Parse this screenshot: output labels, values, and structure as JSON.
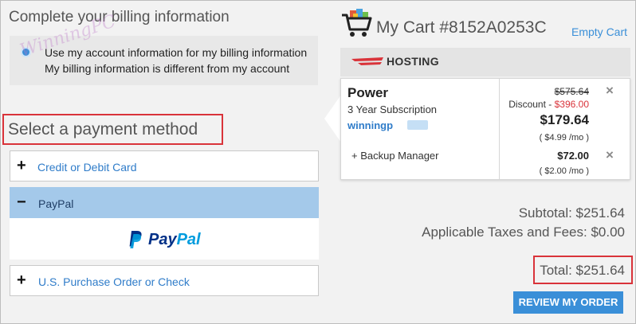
{
  "billing": {
    "title": "Complete your billing information",
    "option_account": "Use my account information for my billing information",
    "option_different": "My billing information is different from my account",
    "watermark": "WinningPC"
  },
  "payment": {
    "title": "Select a payment method",
    "options": [
      {
        "sign": "+",
        "label": "Credit or Debit Card",
        "expanded": false
      },
      {
        "sign": "−",
        "label": "PayPal",
        "expanded": true
      },
      {
        "sign": "+",
        "label": "U.S. Purchase Order or Check",
        "expanded": false
      }
    ],
    "paypal_logo": {
      "word_pay": "Pay",
      "word_pal": "Pal"
    }
  },
  "cart": {
    "title": "My Cart #8152A0253C",
    "empty_label": "Empty Cart",
    "section": "HOSTING",
    "product": {
      "name": "Power",
      "term": "3 Year Subscription",
      "domain": "winningp",
      "original_price": "$575.64",
      "discount_label": "Discount - ",
      "discount_value": "$396.00",
      "price": "$179.64",
      "per_month": "( $4.99 /mo )"
    },
    "addon": {
      "name": "+ Backup Manager",
      "price": "$72.00",
      "per_month": "( $2.00 /mo )"
    },
    "remove_icon": "×"
  },
  "summary": {
    "subtotal": "Subtotal: $251.64",
    "taxes": "Applicable Taxes and Fees: $0.00",
    "total": "Total: $251.64",
    "review_button": "REVIEW MY ORDER"
  },
  "colors": {
    "accent": "#3a8fd8",
    "highlight_border": "#d9333a",
    "paypal_row": "#a4c9ea",
    "discount_red": "#d9333a"
  }
}
